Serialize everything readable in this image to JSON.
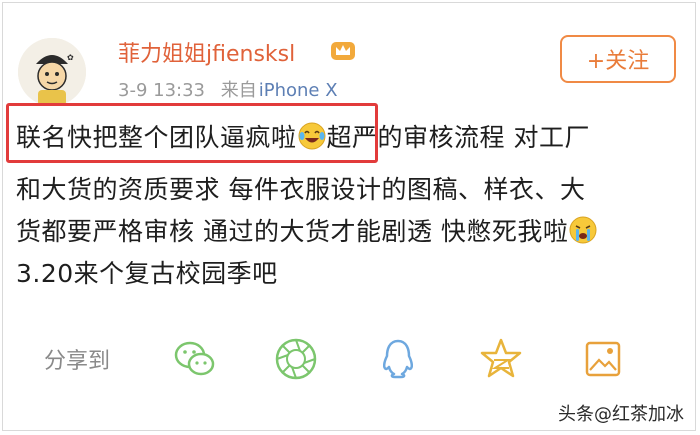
{
  "header": {
    "username": "菲力姐姐jfiensksl",
    "timestamp": "3-9 13:33",
    "source_prefix": "来自",
    "source": "iPhone X",
    "follow_label": "+关注"
  },
  "post": {
    "lines": [
      {
        "text_a": "联名快把整个团队逼疯啦",
        "emoji": "laughing-tears-emoji",
        "text_b": "超严的审核流程 对工厂"
      },
      {
        "text_a": "和大货的资质要求 每件衣服设计的图稿、样衣、大"
      },
      {
        "text_a": "货都要严格审核 通过的大货才能剧透 快憋死我啦",
        "emoji": "crying-emoji"
      },
      {
        "text_a": "3.20来个复古校园季吧"
      }
    ]
  },
  "share": {
    "label": "分享到",
    "targets": [
      "wechat-icon",
      "moments-icon",
      "qq-icon",
      "qzone-icon",
      "save-image-icon"
    ]
  },
  "watermark": "头条@红茶加冰",
  "colors": {
    "username": "#e0623a",
    "follow": "#f08a45",
    "source": "#5d7fb4",
    "highlight": "#e23b3b",
    "icon_green": "#7cc66d"
  }
}
